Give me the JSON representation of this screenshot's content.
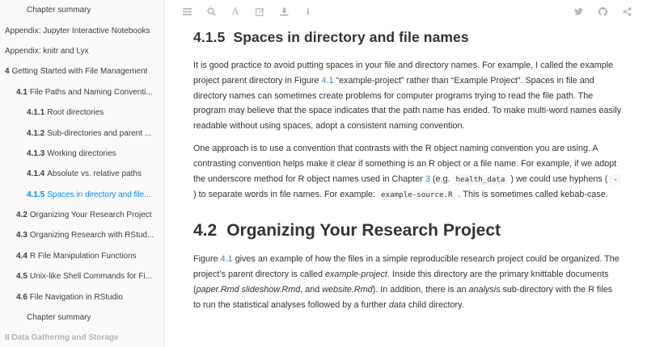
{
  "sidebar": {
    "items": [
      {
        "num": "",
        "label": "Chapter summary",
        "level": 2,
        "state": ""
      },
      {
        "num": "",
        "label": "Appendix: Jupyter Interactive Notebooks",
        "level": 0,
        "state": ""
      },
      {
        "num": "",
        "label": "Appendix: knitr and Lyx",
        "level": 0,
        "state": ""
      },
      {
        "num": "4",
        "label": "Getting Started with File Management",
        "level": 0,
        "state": ""
      },
      {
        "num": "4.1",
        "label": "File Paths and Naming Conventi...",
        "level": 1,
        "state": ""
      },
      {
        "num": "4.1.1",
        "label": "Root directories",
        "level": 2,
        "state": ""
      },
      {
        "num": "4.1.2",
        "label": "Sub-directories and parent ...",
        "level": 2,
        "state": ""
      },
      {
        "num": "4.1.3",
        "label": "Working directories",
        "level": 2,
        "state": ""
      },
      {
        "num": "4.1.4",
        "label": "Absolute vs. relative paths",
        "level": 2,
        "state": ""
      },
      {
        "num": "4.1.5",
        "label": "Spaces in directory and file...",
        "level": 2,
        "state": "active"
      },
      {
        "num": "4.2",
        "label": "Organizing Your Research Project",
        "level": 1,
        "state": ""
      },
      {
        "num": "4.3",
        "label": "Organizing Research with RStud...",
        "level": 1,
        "state": ""
      },
      {
        "num": "4.4",
        "label": "R File Manipulation Functions",
        "level": 1,
        "state": ""
      },
      {
        "num": "4.5",
        "label": "Unix-like Shell Commands for Fi...",
        "level": 1,
        "state": ""
      },
      {
        "num": "4.6",
        "label": "File Navigation in RStudio",
        "level": 1,
        "state": ""
      },
      {
        "num": "",
        "label": "Chapter summary",
        "level": 2,
        "state": ""
      },
      {
        "num": "",
        "label": "II Data Gathering and Storage",
        "level": 0,
        "state": "part"
      }
    ]
  },
  "toolbar": {
    "left_icons": [
      "menu-icon",
      "search-icon",
      "font-icon",
      "edit-icon",
      "download-icon",
      "info-icon"
    ],
    "right_icons": [
      "twitter-icon",
      "github-icon",
      "share-icon"
    ],
    "font_glyph": "A",
    "info_glyph": "i"
  },
  "section_415": {
    "num": "4.1.5",
    "title": "Spaces in directory and file names",
    "p1": {
      "a": "It is good practice to avoid putting spaces in your file and directory names. For example, I called the example project parent directory in Figure ",
      "ref": "4.1",
      "b": " “example-project” rather than “Example Project”. Spaces in file and directory names can sometimes create problems for computer programs trying to read the file path. The program may believe that the space indicates that the path name has ended. To make multi-word names easily readable without using spaces, adopt a consistent naming convention."
    },
    "p2": {
      "a": "One approach is to use a convention that contrasts with the R object naming convention you are using. A contrasting convention helps make it clear if something is an R object or a file name. For example, if we adopt the underscore method for R object names used in Chapter ",
      "ref": "3",
      "b": " (e.g. ",
      "code1": "health_data",
      "c": " ) we could use hyphens ( ",
      "code2": "-",
      "d": " ) to separate words in file names. For example: ",
      "code3": "example-source.R",
      "e": " . This is sometimes called kebab-case."
    }
  },
  "section_42": {
    "num": "4.2",
    "title": "Organizing Your Research Project",
    "p1": {
      "a": "Figure ",
      "ref": "4.1",
      "b": " gives an example of how the files in a simple reproducible research project could be organized. The project’s parent directory is called ",
      "em1": "example-project",
      "c": ". Inside this directory are the primary knittable documents (",
      "em2": "paper.Rmd slideshow.Rmd",
      "d": ", and ",
      "em3": "website.Rmd",
      "e": "). In addition, there is an ",
      "em4": "analysis",
      "f": " sub-directory with the R files to run the statistical analyses followed by a further ",
      "em5": "data",
      "g": " child directory."
    }
  },
  "colors": {
    "link": "#4183c4",
    "active_toc": "#008cff",
    "sidebar_bg": "#fafafa",
    "toolbar_icon": "#b6b6b6"
  }
}
